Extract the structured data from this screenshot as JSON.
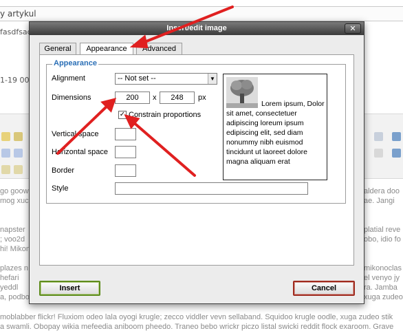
{
  "background": {
    "title_field_value": "y artykul",
    "side_text_1": "fasdfsadf",
    "side_text_2": "1-19 00",
    "body_left_lines": [
      "go goowy",
      "mog xuc",
      "",
      "napster",
      "; voo2d",
      "hi! Mikono",
      "",
      "plazes n",
      "hefari",
      "yeddl",
      "a, podbo"
    ],
    "body_right_lines": [
      "aldera doo",
      "ae. Jangi",
      "",
      "platial reve",
      "obo, idio fo",
      "",
      "mikonoclas",
      "el venyo jy",
      "ra. Jamba",
      "xuga zudeo stik"
    ],
    "bottom_lines": [
      "moblabber flickr! Fluxiom odeo lala oyogi krugle; zecco viddler vevn sellaband. Squidoo krugle oodle, xuga zudeo stik",
      "a swamli. Obopay wikia mefeedia aniboom pheedo. Traneo bebo wrickr piczo listal swicki reddit flock exaroom. Grave"
    ]
  },
  "dialog": {
    "title": "Insert/edit image",
    "close_glyph": "✕",
    "tabs": [
      {
        "label": "General"
      },
      {
        "label": "Appearance"
      },
      {
        "label": "Advanced"
      }
    ],
    "active_tab": "Appearance",
    "legend": "Appearance",
    "alignment": {
      "label": "Alignment",
      "value": "-- Not set --"
    },
    "dimensions": {
      "label": "Dimensions",
      "width": "200",
      "separator": "x",
      "height": "248",
      "unit": "px"
    },
    "constrain": {
      "label": "Constrain proportions",
      "checked": true,
      "check_glyph": "✓"
    },
    "vertical_space": {
      "label": "Vertical space",
      "value": ""
    },
    "horizontal_space": {
      "label": "Horizontal space",
      "value": ""
    },
    "border": {
      "label": "Border",
      "value": ""
    },
    "style": {
      "label": "Style",
      "value": ""
    },
    "preview_text": "Lorem ipsum, Dolor sit amet, consectetuer adipiscing loreum ipsum edipiscing elit, sed diam nonummy nibh euismod tincidunt ut laoreet dolore magna aliquam erat",
    "insert_label": "Insert",
    "cancel_label": "Cancel"
  },
  "colors": {
    "arrow": "#e02020",
    "legend": "#2b6fb6",
    "insert_border": "#5e8c1c",
    "cancel_border": "#9f2a1e"
  }
}
